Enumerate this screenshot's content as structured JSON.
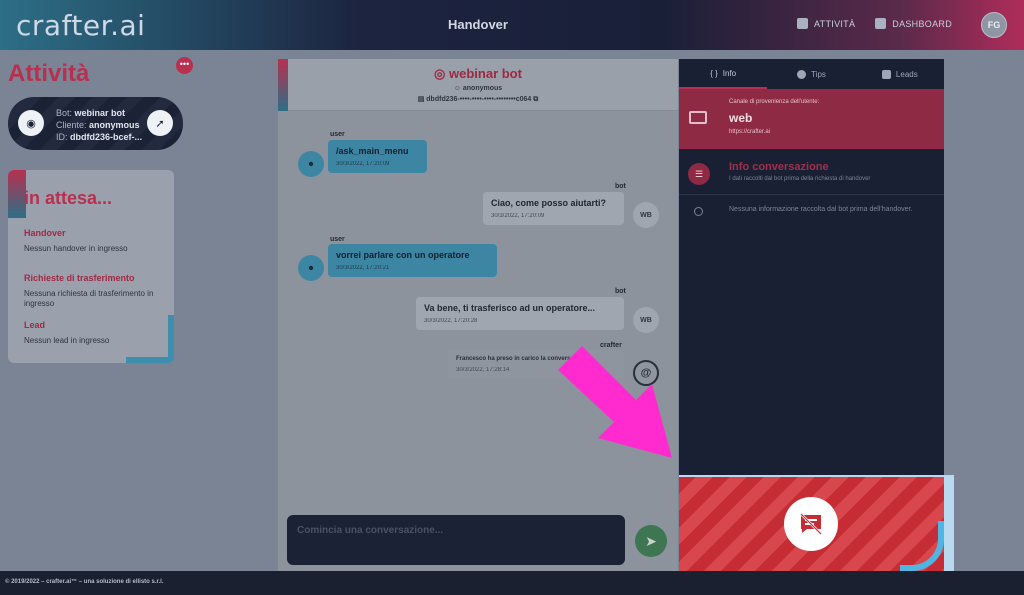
{
  "header": {
    "logo": "crafter.ai",
    "title": "Handover",
    "nav": [
      {
        "label": "ATTIVITÀ",
        "icon": "activity-icon"
      },
      {
        "label": "DASHBOARD",
        "icon": "dashboard-icon"
      }
    ],
    "user_initials": "FG"
  },
  "left": {
    "title": "Attività",
    "menu_label": "•••",
    "bot_card": {
      "bot_label": "Bot:",
      "bot_value": "webinar bot",
      "client_label": "Cliente:",
      "client_value": "anonymous",
      "id_label": "ID:",
      "id_value": "dbdfd236-bcef-..."
    },
    "waiting": {
      "title": "in attesa...",
      "sections": [
        {
          "heading": "Handover",
          "text": "Nessun handover in ingresso"
        },
        {
          "heading": "Richieste di trasferimento",
          "text": "Nessuna richiesta di trasferimento in ingresso"
        },
        {
          "heading": "Lead",
          "text": "Nessun lead in ingresso"
        }
      ]
    }
  },
  "chat": {
    "bot_name": "webinar bot",
    "user": "anonymous",
    "conversation_id": "dbdfd236-••••-••••-••••-••••••••c064",
    "messages": [
      {
        "sender": "user",
        "text": "/ask_main_menu",
        "time": "30/3/2022, 17:20:09"
      },
      {
        "sender": "bot",
        "text": "Ciao, come posso aiutarti?",
        "time": "30/3/2022, 17:20:09",
        "avatar": "WB"
      },
      {
        "sender": "user",
        "text": "vorrei parlare con un operatore",
        "time": "30/3/2022, 17:20:21"
      },
      {
        "sender": "bot",
        "text": "Va bene, ti trasferisco ad un operatore...",
        "time": "30/3/2022, 17:20:28",
        "avatar": "WB"
      },
      {
        "sender": "crafter",
        "text": "Francesco ha preso in carico la conversazione",
        "time": "30/3/2022, 17:28:14"
      }
    ],
    "compose_placeholder": "Comincia una conversazione..."
  },
  "right": {
    "tabs": [
      {
        "label": "Info",
        "active": true
      },
      {
        "label": "Tips",
        "active": false
      },
      {
        "label": "Leads",
        "active": false
      }
    ],
    "origin_label": "Canale di provenienza dell'utente:",
    "origin_value": "web",
    "origin_url": "https://crafter.ai",
    "info_title": "Info conversazione",
    "info_subtitle": "I dati raccolti dal bot prima della richiesta di handover",
    "no_info": "Nessuna informazione raccolta dal bot prima dell'handover."
  },
  "footer": "© 2019/2022 – crafter.ai™ – una soluzione di ellisto s.r.l.",
  "colors": {
    "accent": "#b8304f",
    "user_bubble": "#3c86a3",
    "panel_dark": "#1a2033",
    "arrow": "#ff2bcf",
    "striped_red": "#c62c34"
  }
}
